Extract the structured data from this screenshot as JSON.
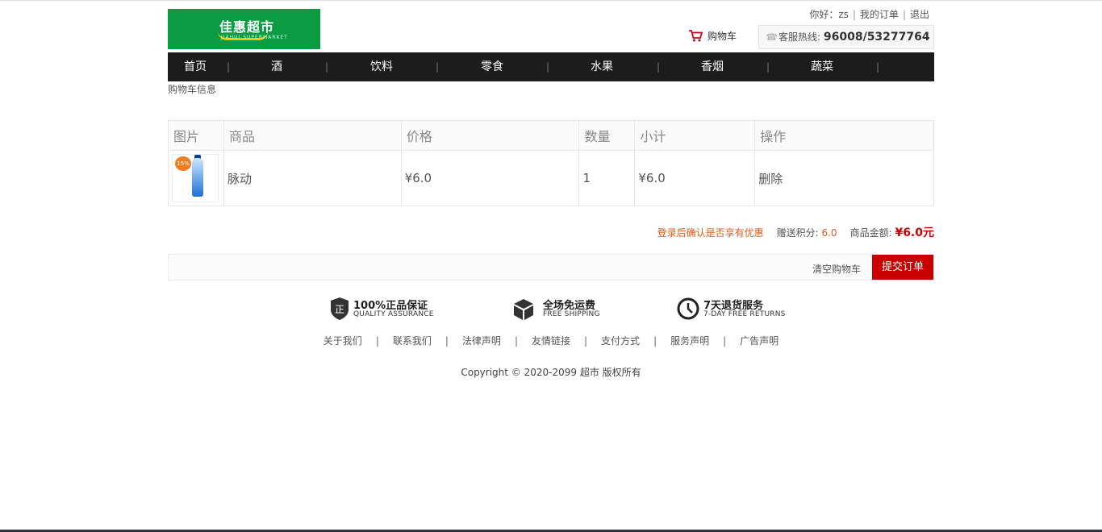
{
  "header": {
    "logo_text": "佳惠超市",
    "logo_subtext": "JIAHUI SUPERMARKET",
    "user_greeting": "你好：zs",
    "my_orders": "我的订单",
    "logout": "退出",
    "cart_label": "购物车",
    "hotline_label": "客服热线:",
    "hotline_number": "96008/53277764"
  },
  "nav": {
    "items": [
      "首页",
      "酒",
      "饮料",
      "零食",
      "水果",
      "香烟",
      "蔬菜"
    ],
    "separator": "|"
  },
  "breadcrumb": "购物车信息",
  "cart_table": {
    "columns": [
      "图片",
      "商品",
      "价格",
      "数量",
      "小计",
      "操作"
    ],
    "rows": [
      {
        "badge": "15%",
        "name": "脉动",
        "price": "¥6.0",
        "quantity": "1",
        "subtotal": "¥6.0",
        "action": "删除"
      }
    ]
  },
  "summary": {
    "login_notice": "登录后确认是否享有优惠",
    "points_label": "赠送积分:",
    "points_value": "6.0",
    "amount_label": "商品金额:",
    "amount_value": "¥6.0元"
  },
  "actions": {
    "clear_cart": "清空购物车",
    "submit_order": "提交订单"
  },
  "features": [
    {
      "icon": "shield-icon",
      "icon_text": "正",
      "title": "100%正品保证",
      "subtitle": "QUALITY ASSURANCE"
    },
    {
      "icon": "box-icon",
      "title": "全场免运费",
      "subtitle": "FREE SHIPPING"
    },
    {
      "icon": "clock-icon",
      "title": "7天退货服务",
      "subtitle": "7-DAY FREE RETURNS"
    }
  ],
  "footer": {
    "links": [
      "关于我们",
      "联系我们",
      "法律声明",
      "友情链接",
      "支付方式",
      "服务声明",
      "广告声明"
    ],
    "copyright": "Copyright © 2020-2099 超市 版权所有"
  },
  "colors": {
    "brand_green": "#0a9b43",
    "nav_bg": "#1c1c1c",
    "accent_red": "#c90000",
    "notice_orange": "#e05a1a"
  }
}
